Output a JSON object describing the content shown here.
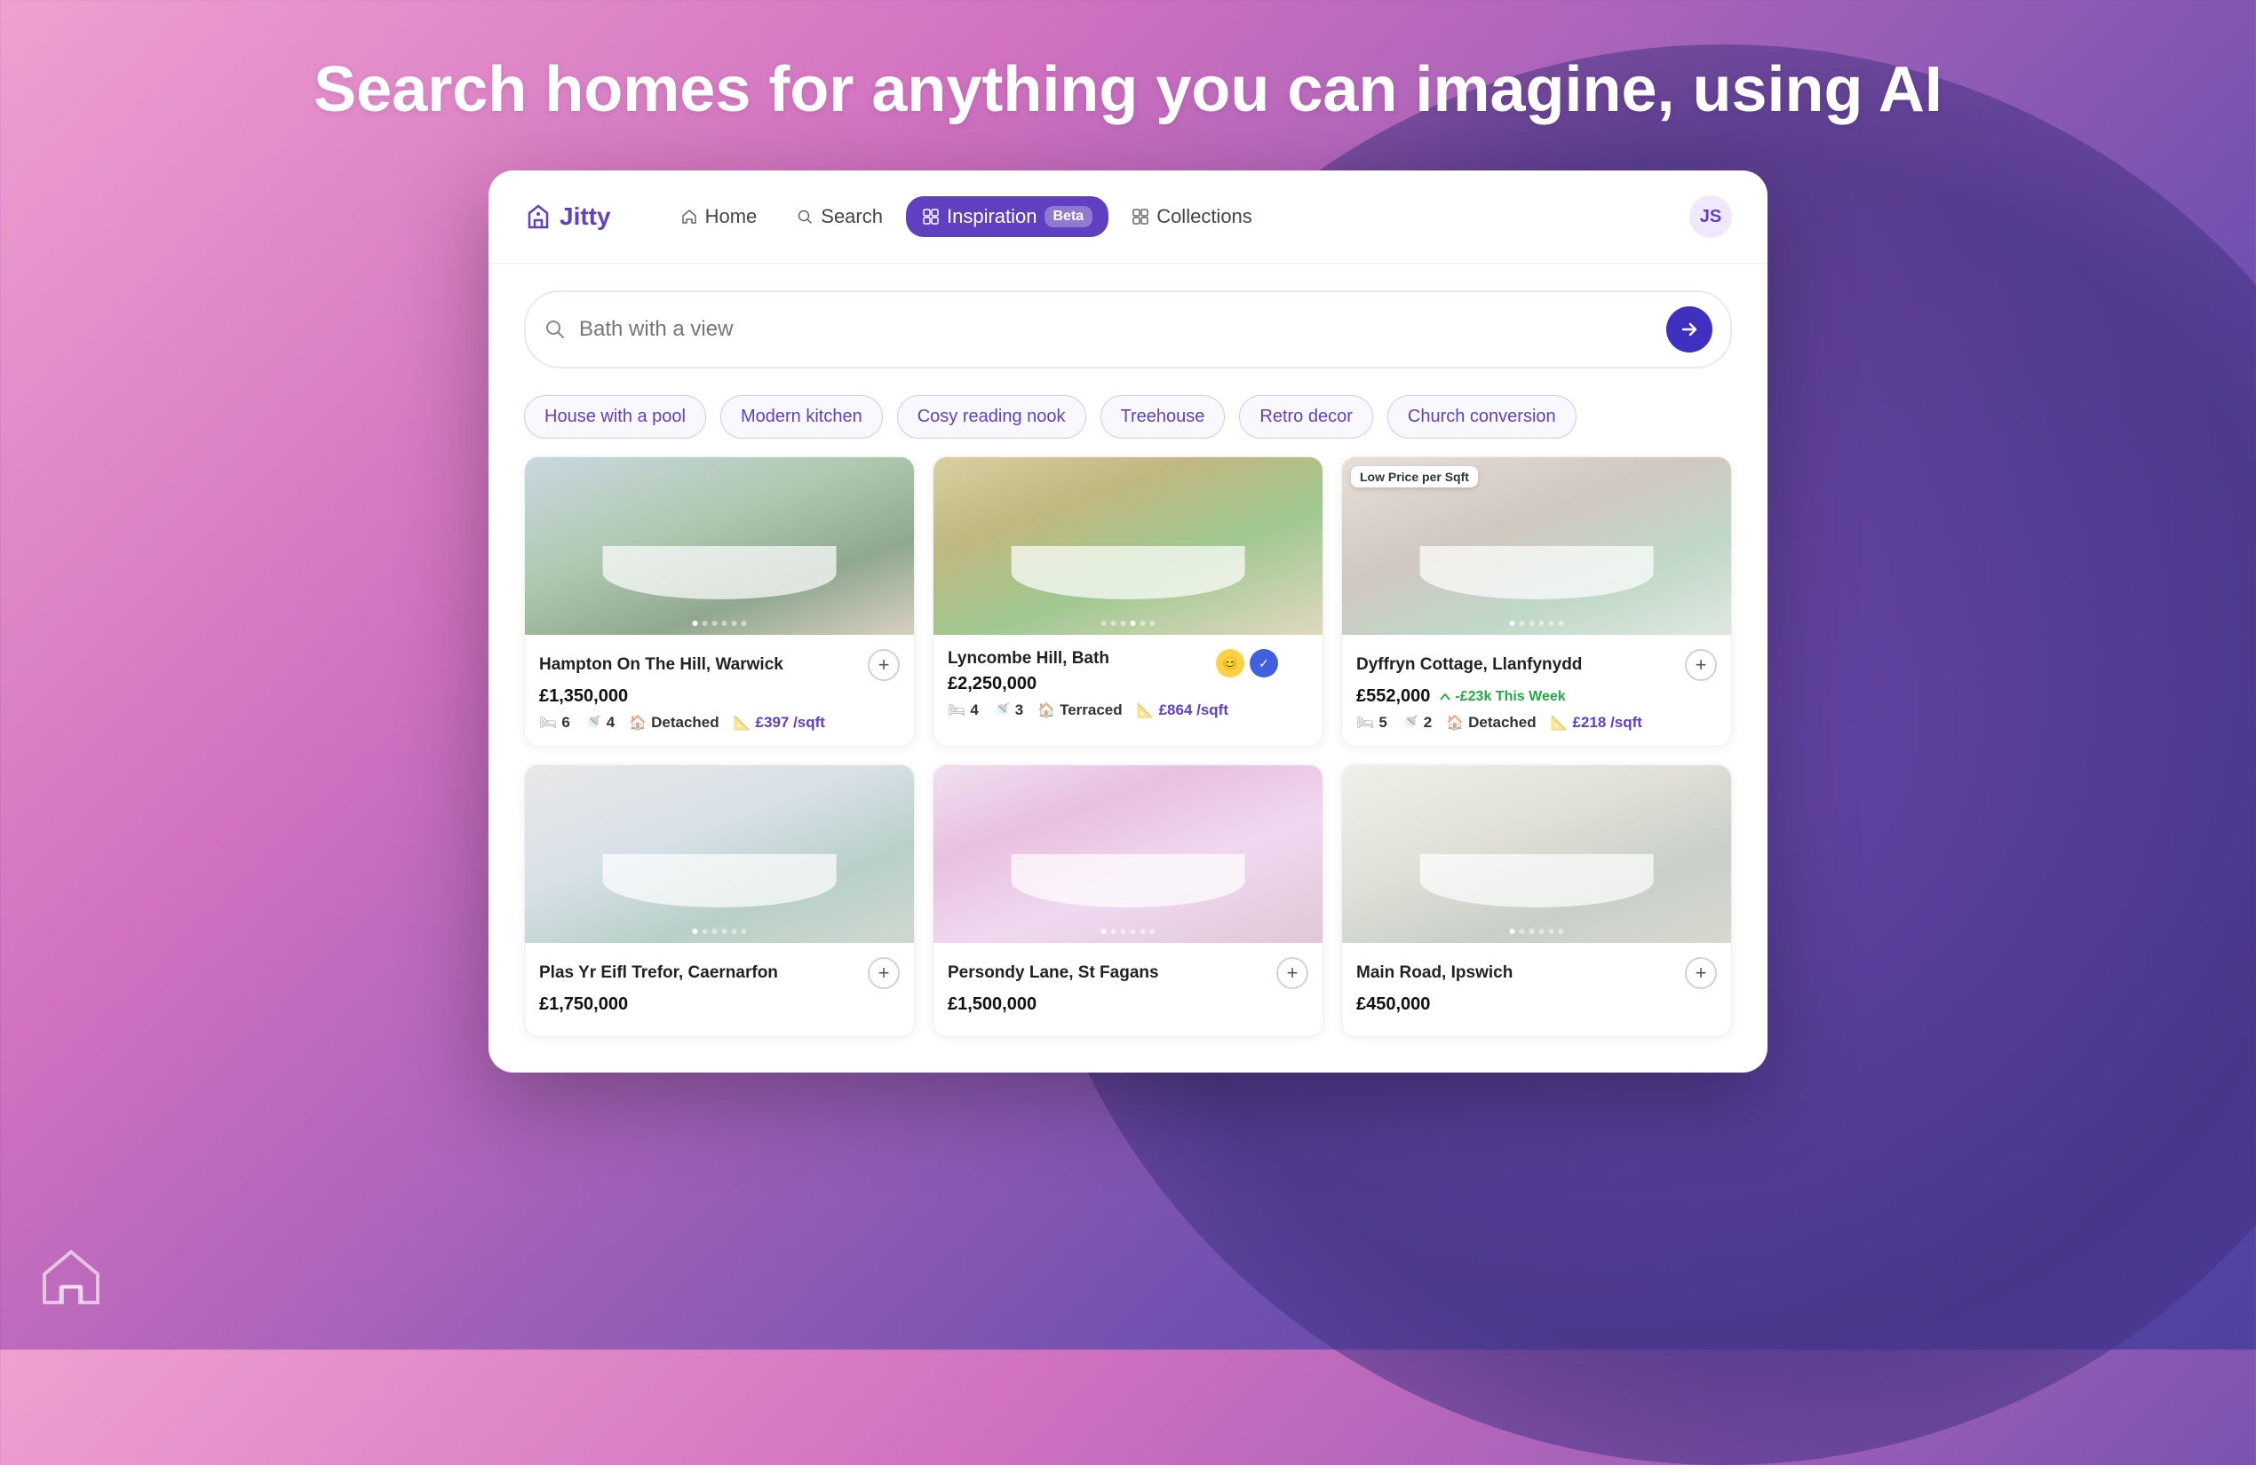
{
  "page": {
    "headline": "Search homes for anything you can imagine, using AI"
  },
  "nav": {
    "logo": "Jitty",
    "items": [
      {
        "id": "home",
        "label": "Home",
        "active": false
      },
      {
        "id": "search",
        "label": "Search",
        "active": false
      },
      {
        "id": "inspiration",
        "label": "Inspiration",
        "active": true,
        "badge": "Beta"
      },
      {
        "id": "collections",
        "label": "Collections",
        "active": false
      }
    ],
    "user_initials": "JS"
  },
  "search": {
    "placeholder": "Bath with a view",
    "value": "Bath with a view",
    "submit_aria": "Search"
  },
  "chips": [
    "House with a pool",
    "Modern kitchen",
    "Cosy reading nook",
    "Treehouse",
    "Retro decor",
    "Church conversion"
  ],
  "properties": [
    {
      "id": 1,
      "name": "Hampton On The Hill, Warwick",
      "price": "£1,350,000",
      "beds": 6,
      "baths": 4,
      "type": "Detached",
      "sqft": "£397 /sqft",
      "img_class": "img-1",
      "badge": null,
      "price_drop": null,
      "dots": [
        true,
        false,
        false,
        false,
        false,
        false,
        false
      ]
    },
    {
      "id": 2,
      "name": "Lyncombe Hill, Bath",
      "price": "£2,250,000",
      "beds": 4,
      "baths": 3,
      "type": "Terraced",
      "sqft": "£864 /sqft",
      "img_class": "img-2",
      "badge": null,
      "price_drop": null,
      "has_action_badges": true,
      "dots": [
        false,
        false,
        false,
        false,
        false,
        false,
        false
      ]
    },
    {
      "id": 3,
      "name": "Dyffryn Cottage, Llanfynydd",
      "price": "£552,000",
      "beds": 5,
      "baths": 2,
      "type": "Detached",
      "sqft": "£218 /sqft",
      "img_class": "img-3",
      "badge": "Low Price per Sqft",
      "price_drop": "-£23k This Week",
      "dots": [
        true,
        false,
        false,
        false,
        false,
        false,
        false
      ]
    },
    {
      "id": 4,
      "name": "Plas Yr Eifl Trefor, Caernarfon",
      "price": "£1,750,000",
      "beds": 0,
      "baths": 0,
      "type": "",
      "sqft": "",
      "img_class": "img-4",
      "badge": null,
      "price_drop": null,
      "dots": [
        true,
        false,
        false,
        false,
        false,
        false,
        false
      ]
    },
    {
      "id": 5,
      "name": "Persondy Lane, St Fagans",
      "price": "£1,500,000",
      "beds": 0,
      "baths": 0,
      "type": "",
      "sqft": "",
      "img_class": "img-5",
      "badge": null,
      "price_drop": null,
      "dots": [
        true,
        false,
        false,
        false,
        false,
        false,
        false
      ]
    },
    {
      "id": 6,
      "name": "Main Road, Ipswich",
      "price": "£450,000",
      "beds": 0,
      "baths": 0,
      "type": "",
      "sqft": "",
      "img_class": "img-6",
      "badge": null,
      "price_drop": null,
      "dots": [
        true,
        false,
        false,
        false,
        false,
        false,
        false
      ]
    }
  ]
}
